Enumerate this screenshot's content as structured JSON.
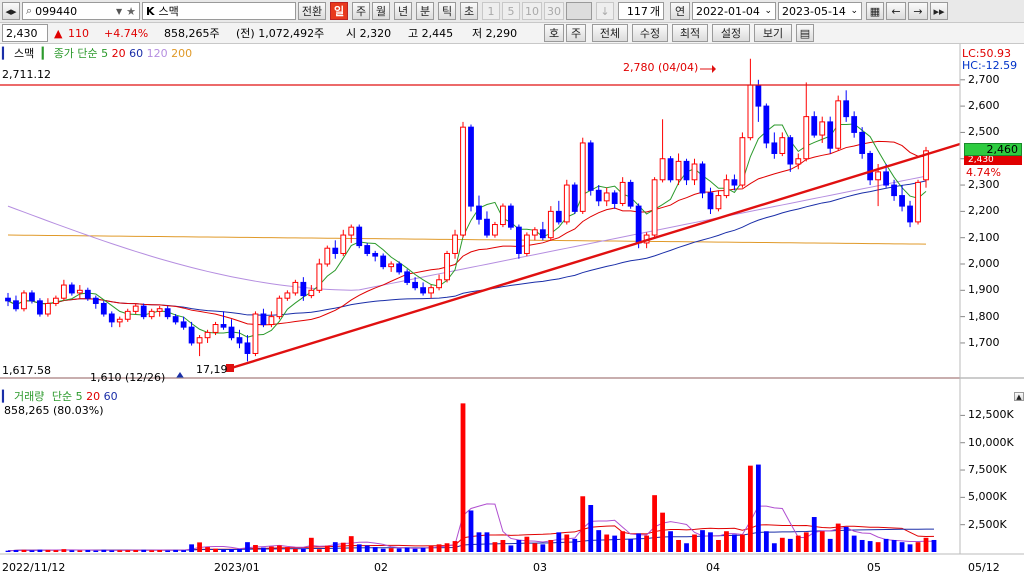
{
  "toolbar": {
    "nav_icon": "◂▸",
    "search_icon": "⌕",
    "code": "099440",
    "dropdown_icon": "▼",
    "star_icon": "★",
    "name_prefix": "K",
    "name": "스맥",
    "switch_label": "전환",
    "periods": [
      "일",
      "주",
      "월",
      "년",
      "분",
      "틱",
      "초"
    ],
    "active_period": "일",
    "intervals": [
      "1",
      "5",
      "10",
      "30"
    ],
    "count": "117",
    "count_unit": "개",
    "year_label": "연",
    "start_date": "2022-01-04",
    "end_date": "2023-05-14",
    "icons": [
      "save-icon",
      "arrow-left-icon",
      "arrow-right-icon",
      "play-end-icon"
    ]
  },
  "quote": {
    "price": "2,430",
    "change_arrow": "▲",
    "change": "110",
    "change_pct": "+4.74%",
    "volume": "858,265주",
    "prev_volume": "(전) 1,072,492주",
    "open": "시 2,320",
    "high": "고 2,445",
    "low": "저 2,290",
    "btn_ho": "호",
    "btn_ju": "주",
    "btn_chart": "전체",
    "btn_adjust": "수정",
    "btn_best": "최적",
    "btn_setting": "설정",
    "btn_view": "보기"
  },
  "price_panel": {
    "title": "스맥",
    "ma_label": "종가 단순",
    "ma_periods": [
      "5",
      "20",
      "60",
      "120",
      "200"
    ],
    "ma_colors": [
      "#2c9a2c",
      "#e00000",
      "#1a2ea8",
      "#b58ee0",
      "#e09a2a"
    ],
    "lc": "LC:50.93",
    "hc": "HC:-12.59",
    "max_label": "2,711.12",
    "min_label": "1,617.58",
    "peak_annotation": "2,780 (04/04)",
    "low_annotation": "1,610 (12/26)",
    "low2_annotation": "17,19",
    "current_price_box": "2,460",
    "current_price_box2": "2,430",
    "current_pct": "4.74%",
    "y_ticks": [
      "2,700",
      "2,600",
      "2,500",
      "2,400",
      "2,300",
      "2,200",
      "2,100",
      "2,000",
      "1,900",
      "1,800",
      "1,700"
    ]
  },
  "volume_panel": {
    "title": "거래량",
    "ma_label": "단순",
    "ma_periods": [
      "5",
      "20",
      "60"
    ],
    "value": "858,265 (80.03%)",
    "y_ticks": [
      "12,500K",
      "10,000K",
      "7,500K",
      "5,000K",
      "2,500K"
    ]
  },
  "x_axis": {
    "labels": [
      "2022/11/12",
      "2023/01",
      "02",
      "03",
      "04",
      "05",
      "05/12"
    ]
  },
  "colors": {
    "up": "#ff0000",
    "down": "#0000ff",
    "trendline": "#e01010",
    "hline": "#e01010"
  },
  "chart_data": {
    "type": "candlestick",
    "ylim": [
      1620,
      2760
    ],
    "candles": [
      [
        1870,
        1890,
        1840,
        1860
      ],
      [
        1860,
        1880,
        1820,
        1830
      ],
      [
        1830,
        1900,
        1820,
        1890
      ],
      [
        1890,
        1900,
        1850,
        1860
      ],
      [
        1860,
        1870,
        1800,
        1810
      ],
      [
        1810,
        1870,
        1800,
        1850
      ],
      [
        1850,
        1880,
        1840,
        1870
      ],
      [
        1870,
        1940,
        1860,
        1920
      ],
      [
        1920,
        1930,
        1880,
        1890
      ],
      [
        1890,
        1920,
        1870,
        1900
      ],
      [
        1900,
        1910,
        1860,
        1870
      ],
      [
        1870,
        1880,
        1830,
        1850
      ],
      [
        1850,
        1860,
        1800,
        1810
      ],
      [
        1810,
        1820,
        1760,
        1780
      ],
      [
        1780,
        1800,
        1760,
        1790
      ],
      [
        1790,
        1830,
        1780,
        1820
      ],
      [
        1820,
        1850,
        1810,
        1840
      ],
      [
        1840,
        1850,
        1790,
        1800
      ],
      [
        1800,
        1830,
        1790,
        1820
      ],
      [
        1820,
        1840,
        1800,
        1830
      ],
      [
        1830,
        1840,
        1790,
        1800
      ],
      [
        1800,
        1810,
        1770,
        1780
      ],
      [
        1780,
        1800,
        1750,
        1760
      ],
      [
        1760,
        1780,
        1690,
        1700
      ],
      [
        1700,
        1730,
        1650,
        1720
      ],
      [
        1720,
        1750,
        1700,
        1740
      ],
      [
        1740,
        1780,
        1730,
        1770
      ],
      [
        1770,
        1820,
        1750,
        1760
      ],
      [
        1760,
        1790,
        1710,
        1720
      ],
      [
        1720,
        1750,
        1680,
        1700
      ],
      [
        1700,
        1730,
        1630,
        1660
      ],
      [
        1660,
        1820,
        1650,
        1810
      ],
      [
        1810,
        1830,
        1760,
        1770
      ],
      [
        1770,
        1820,
        1760,
        1800
      ],
      [
        1800,
        1880,
        1790,
        1870
      ],
      [
        1870,
        1900,
        1860,
        1890
      ],
      [
        1890,
        1940,
        1880,
        1930
      ],
      [
        1930,
        1950,
        1860,
        1880
      ],
      [
        1880,
        1920,
        1870,
        1900
      ],
      [
        1900,
        2020,
        1890,
        2000
      ],
      [
        2000,
        2070,
        1990,
        2060
      ],
      [
        2060,
        2090,
        2020,
        2040
      ],
      [
        2040,
        2130,
        2030,
        2110
      ],
      [
        2110,
        2150,
        2080,
        2140
      ],
      [
        2140,
        2150,
        2060,
        2070
      ],
      [
        2070,
        2080,
        2030,
        2040
      ],
      [
        2040,
        2050,
        2010,
        2030
      ],
      [
        2030,
        2040,
        1980,
        1990
      ],
      [
        1990,
        2010,
        1970,
        2000
      ],
      [
        2000,
        2010,
        1960,
        1970
      ],
      [
        1970,
        1980,
        1920,
        1930
      ],
      [
        1930,
        1950,
        1900,
        1910
      ],
      [
        1910,
        1930,
        1880,
        1890
      ],
      [
        1890,
        1920,
        1870,
        1910
      ],
      [
        1910,
        1960,
        1900,
        1940
      ],
      [
        1940,
        2050,
        1930,
        2040
      ],
      [
        2040,
        2130,
        2020,
        2110
      ],
      [
        2110,
        2540,
        2100,
        2520
      ],
      [
        2520,
        2530,
        2200,
        2220
      ],
      [
        2220,
        2260,
        2150,
        2170
      ],
      [
        2170,
        2200,
        2100,
        2110
      ],
      [
        2110,
        2160,
        2100,
        2150
      ],
      [
        2150,
        2230,
        2140,
        2220
      ],
      [
        2220,
        2230,
        2130,
        2140
      ],
      [
        2140,
        2150,
        2020,
        2040
      ],
      [
        2040,
        2120,
        2030,
        2110
      ],
      [
        2110,
        2140,
        2090,
        2130
      ],
      [
        2130,
        2160,
        2090,
        2100
      ],
      [
        2100,
        2220,
        2090,
        2200
      ],
      [
        2200,
        2240,
        2150,
        2160
      ],
      [
        2160,
        2320,
        2150,
        2300
      ],
      [
        2300,
        2310,
        2190,
        2200
      ],
      [
        2200,
        2480,
        2190,
        2460
      ],
      [
        2460,
        2470,
        2260,
        2280
      ],
      [
        2280,
        2300,
        2220,
        2240
      ],
      [
        2240,
        2290,
        2220,
        2270
      ],
      [
        2270,
        2280,
        2210,
        2230
      ],
      [
        2230,
        2330,
        2220,
        2310
      ],
      [
        2310,
        2320,
        2210,
        2220
      ],
      [
        2220,
        2230,
        2060,
        2080
      ],
      [
        2080,
        2120,
        2060,
        2110
      ],
      [
        2110,
        2330,
        2100,
        2320
      ],
      [
        2320,
        2550,
        2310,
        2400
      ],
      [
        2400,
        2410,
        2310,
        2320
      ],
      [
        2320,
        2420,
        2300,
        2390
      ],
      [
        2390,
        2400,
        2300,
        2320
      ],
      [
        2320,
        2400,
        2300,
        2380
      ],
      [
        2380,
        2390,
        2250,
        2270
      ],
      [
        2270,
        2290,
        2190,
        2210
      ],
      [
        2210,
        2280,
        2200,
        2260
      ],
      [
        2260,
        2340,
        2250,
        2320
      ],
      [
        2320,
        2340,
        2280,
        2300
      ],
      [
        2300,
        2500,
        2290,
        2480
      ],
      [
        2480,
        2780,
        2470,
        2680
      ],
      [
        2680,
        2700,
        2540,
        2600
      ],
      [
        2600,
        2610,
        2440,
        2460
      ],
      [
        2460,
        2500,
        2400,
        2420
      ],
      [
        2420,
        2500,
        2410,
        2480
      ],
      [
        2480,
        2490,
        2350,
        2380
      ],
      [
        2380,
        2420,
        2360,
        2400
      ],
      [
        2400,
        2690,
        2390,
        2560
      ],
      [
        2560,
        2580,
        2480,
        2490
      ],
      [
        2490,
        2560,
        2460,
        2540
      ],
      [
        2540,
        2560,
        2420,
        2440
      ],
      [
        2440,
        2640,
        2430,
        2620
      ],
      [
        2620,
        2660,
        2540,
        2560
      ],
      [
        2560,
        2580,
        2480,
        2500
      ],
      [
        2500,
        2520,
        2400,
        2420
      ],
      [
        2420,
        2430,
        2300,
        2320
      ],
      [
        2320,
        2380,
        2220,
        2350
      ],
      [
        2350,
        2380,
        2290,
        2300
      ],
      [
        2300,
        2320,
        2240,
        2260
      ],
      [
        2260,
        2300,
        2200,
        2220
      ],
      [
        2220,
        2240,
        2140,
        2160
      ],
      [
        2160,
        2320,
        2150,
        2310
      ],
      [
        2320,
        2445,
        2290,
        2430
      ]
    ],
    "volumes": [
      120,
      180,
      200,
      160,
      210,
      190,
      170,
      260,
      150,
      140,
      180,
      130,
      200,
      150,
      160,
      170,
      180,
      200,
      160,
      180,
      140,
      190,
      170,
      700,
      880,
      450,
      300,
      200,
      260,
      280,
      900,
      640,
      400,
      500,
      600,
      450,
      280,
      320,
      1300,
      260,
      580,
      900,
      850,
      1450,
      700,
      600,
      450,
      300,
      350,
      320,
      400,
      300,
      380,
      560,
      700,
      800,
      1000,
      13600,
      3800,
      1800,
      1800,
      900,
      1100,
      600,
      1100,
      1400,
      800,
      700,
      1100,
      1800,
      1600,
      1200,
      5100,
      4300,
      2000,
      1600,
      1500,
      1900,
      1200,
      1700,
      1500,
      5200,
      3600,
      1900,
      1100,
      800,
      1600,
      2000,
      1800,
      1100,
      1900,
      1600,
      1600,
      7900,
      8000,
      1900,
      800,
      1300,
      1200,
      1500,
      1800,
      3200,
      1900,
      1200,
      2600,
      2300,
      1500,
      1100,
      1000,
      900,
      1200,
      1100,
      900,
      700,
      900,
      1300,
      1100
    ],
    "volume_ylim": [
      0,
      14000
    ]
  }
}
